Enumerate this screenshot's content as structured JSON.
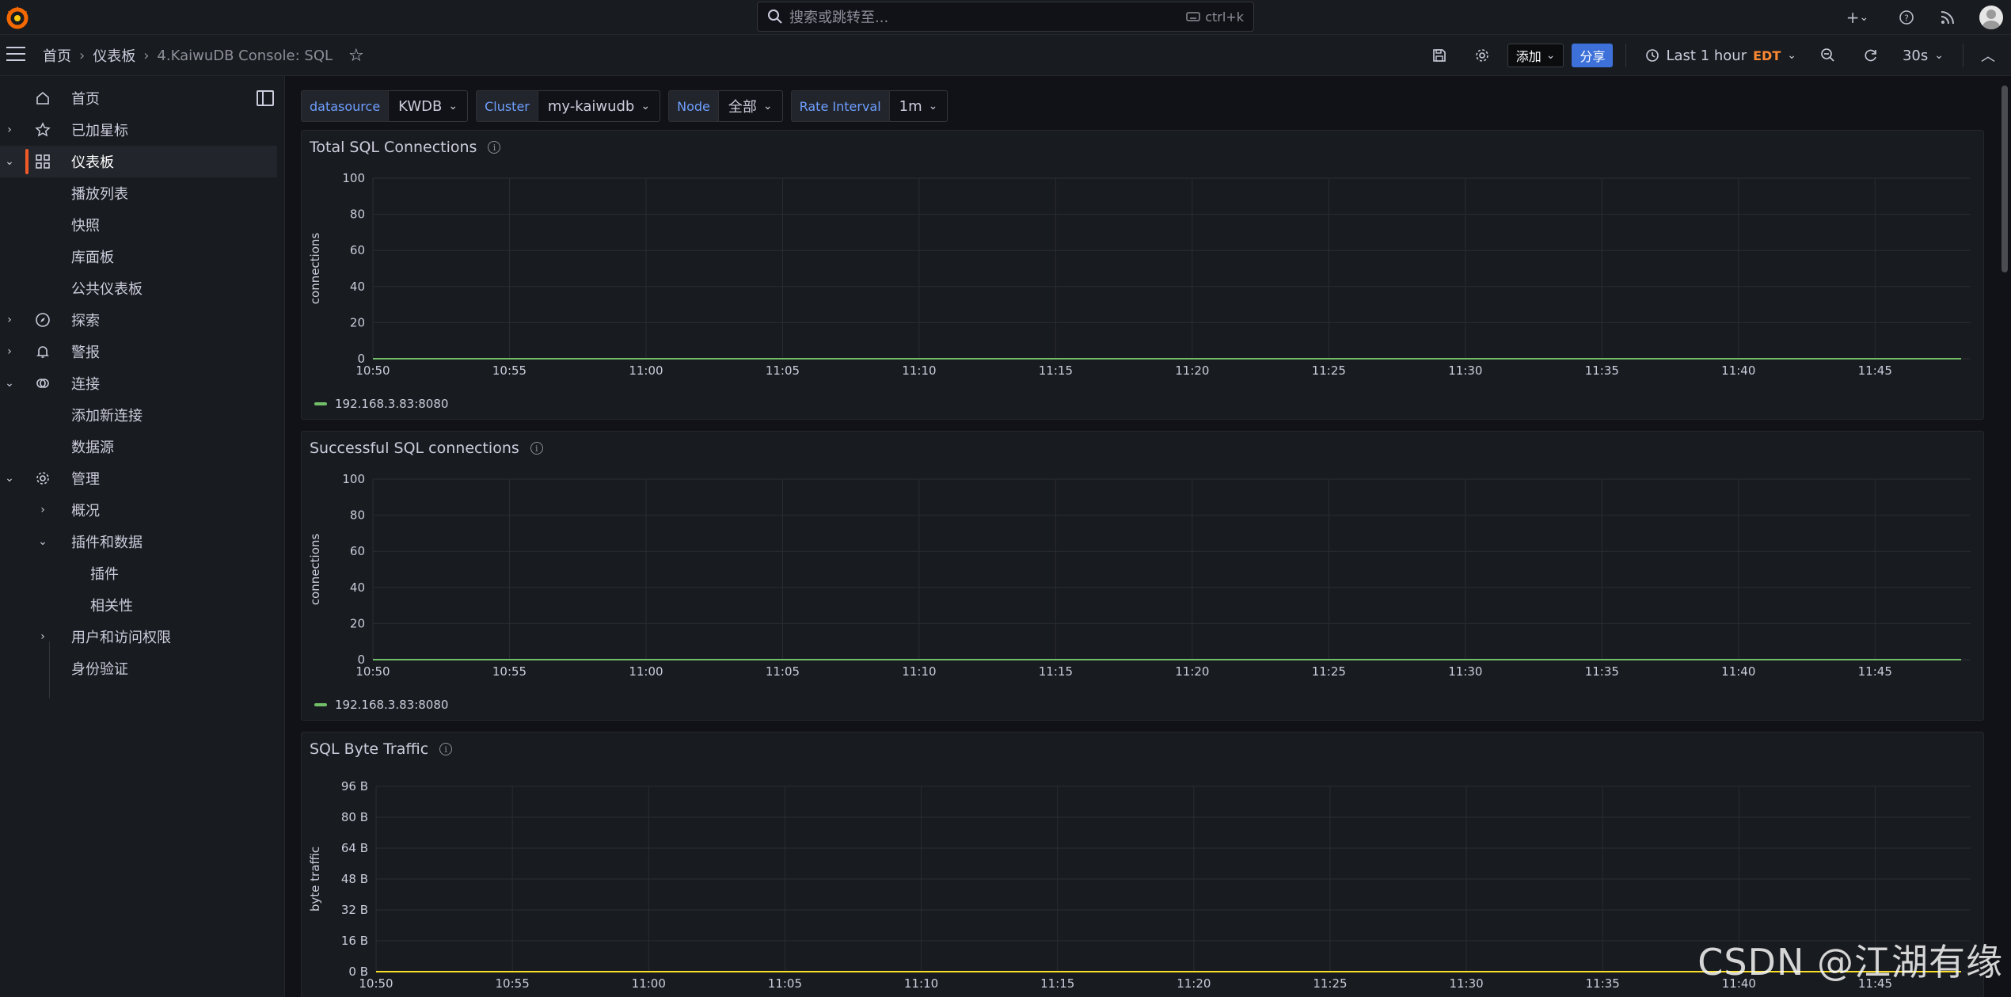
{
  "topbar": {
    "search_placeholder": "搜索或跳转至...",
    "search_shortcut": "ctrl+k"
  },
  "breadcrumb": [
    "首页",
    "仪表板",
    "4.KaiwuDB Console: SQL"
  ],
  "toolbar": {
    "add_label": "添加",
    "share_label": "分享",
    "time_range": "Last 1 hour",
    "timezone": "EDT",
    "refresh_interval": "30s"
  },
  "sidebar": {
    "items": [
      {
        "label": "首页",
        "icon": "home-icon",
        "expand": ""
      },
      {
        "label": "已加星标",
        "icon": "star-icon",
        "expand": "›"
      },
      {
        "label": "仪表板",
        "icon": "apps-icon",
        "expand": "⌄"
      },
      {
        "label": "播放列表",
        "icon": "",
        "expand": ""
      },
      {
        "label": "快照",
        "icon": "",
        "expand": ""
      },
      {
        "label": "库面板",
        "icon": "",
        "expand": ""
      },
      {
        "label": "公共仪表板",
        "icon": "",
        "expand": ""
      },
      {
        "label": "探索",
        "icon": "compass-icon",
        "expand": "›"
      },
      {
        "label": "警报",
        "icon": "bell-icon",
        "expand": "›"
      },
      {
        "label": "连接",
        "icon": "link-icon",
        "expand": "⌄"
      },
      {
        "label": "添加新连接",
        "icon": "",
        "expand": ""
      },
      {
        "label": "数据源",
        "icon": "",
        "expand": ""
      },
      {
        "label": "管理",
        "icon": "gear-icon",
        "expand": "⌄"
      },
      {
        "label": "概况",
        "icon": "",
        "expand": "›"
      },
      {
        "label": "插件和数据",
        "icon": "",
        "expand": "⌄"
      },
      {
        "label": "插件",
        "icon": "",
        "expand": ""
      },
      {
        "label": "相关性",
        "icon": "",
        "expand": ""
      },
      {
        "label": "用户和访问权限",
        "icon": "",
        "expand": "›"
      },
      {
        "label": "身份验证",
        "icon": "",
        "expand": ""
      }
    ]
  },
  "variables": [
    {
      "label": "datasource",
      "value": "KWDB"
    },
    {
      "label": "Cluster",
      "value": "my-kaiwudb"
    },
    {
      "label": "Node",
      "value": "全部"
    },
    {
      "label": "Rate Interval",
      "value": "1m"
    }
  ],
  "colors": {
    "series_green": "#73bf69",
    "series_yellow": "#fade2a",
    "accent_orange": "#f05a28",
    "share_blue": "#3d71d9"
  },
  "panels": [
    {
      "title": "Total SQL Connections",
      "ylabel": "connections",
      "yticks": [
        "100",
        "80",
        "60",
        "40",
        "20",
        "0"
      ],
      "legend": "192.168.3.83:8080"
    },
    {
      "title": "Successful SQL connections",
      "ylabel": "connections",
      "yticks": [
        "100",
        "80",
        "60",
        "40",
        "20",
        "0"
      ],
      "legend": "192.168.3.83:8080"
    },
    {
      "title": "SQL Byte Traffic",
      "ylabel": "byte traffic",
      "yticks": [
        "96 B",
        "80 B",
        "64 B",
        "48 B",
        "32 B",
        "16 B",
        "0 B"
      ],
      "legend": ""
    }
  ],
  "xticks": [
    "10:50",
    "10:55",
    "11:00",
    "11:05",
    "11:10",
    "11:15",
    "11:20",
    "11:25",
    "11:30",
    "11:35",
    "11:40",
    "11:45"
  ],
  "watermark": "CSDN @江湖有缘",
  "chart_data": [
    {
      "type": "line",
      "title": "Total SQL Connections",
      "ylabel": "connections",
      "ylim": [
        0,
        100
      ],
      "x": [
        "10:50",
        "10:55",
        "11:00",
        "11:05",
        "11:10",
        "11:15",
        "11:20",
        "11:25",
        "11:30",
        "11:35",
        "11:40",
        "11:45"
      ],
      "series": [
        {
          "name": "192.168.3.83:8080",
          "values": [
            0,
            0,
            0,
            0,
            0,
            0,
            0,
            0,
            0,
            0,
            0,
            0
          ]
        }
      ]
    },
    {
      "type": "line",
      "title": "Successful SQL connections",
      "ylabel": "connections",
      "ylim": [
        0,
        100
      ],
      "x": [
        "10:50",
        "10:55",
        "11:00",
        "11:05",
        "11:10",
        "11:15",
        "11:20",
        "11:25",
        "11:30",
        "11:35",
        "11:40",
        "11:45"
      ],
      "series": [
        {
          "name": "192.168.3.83:8080",
          "values": [
            0,
            0,
            0,
            0,
            0,
            0,
            0,
            0,
            0,
            0,
            0,
            0
          ]
        }
      ]
    },
    {
      "type": "line",
      "title": "SQL Byte Traffic",
      "ylabel": "byte traffic",
      "ylim": [
        0,
        96
      ],
      "x": [
        "10:50",
        "10:55",
        "11:00",
        "11:05",
        "11:10",
        "11:15",
        "11:20",
        "11:25",
        "11:30",
        "11:35",
        "11:40",
        "11:45"
      ],
      "series": [
        {
          "values": [
            0,
            0,
            0,
            0,
            0,
            0,
            0,
            0,
            0,
            0,
            0,
            0
          ]
        }
      ]
    }
  ]
}
